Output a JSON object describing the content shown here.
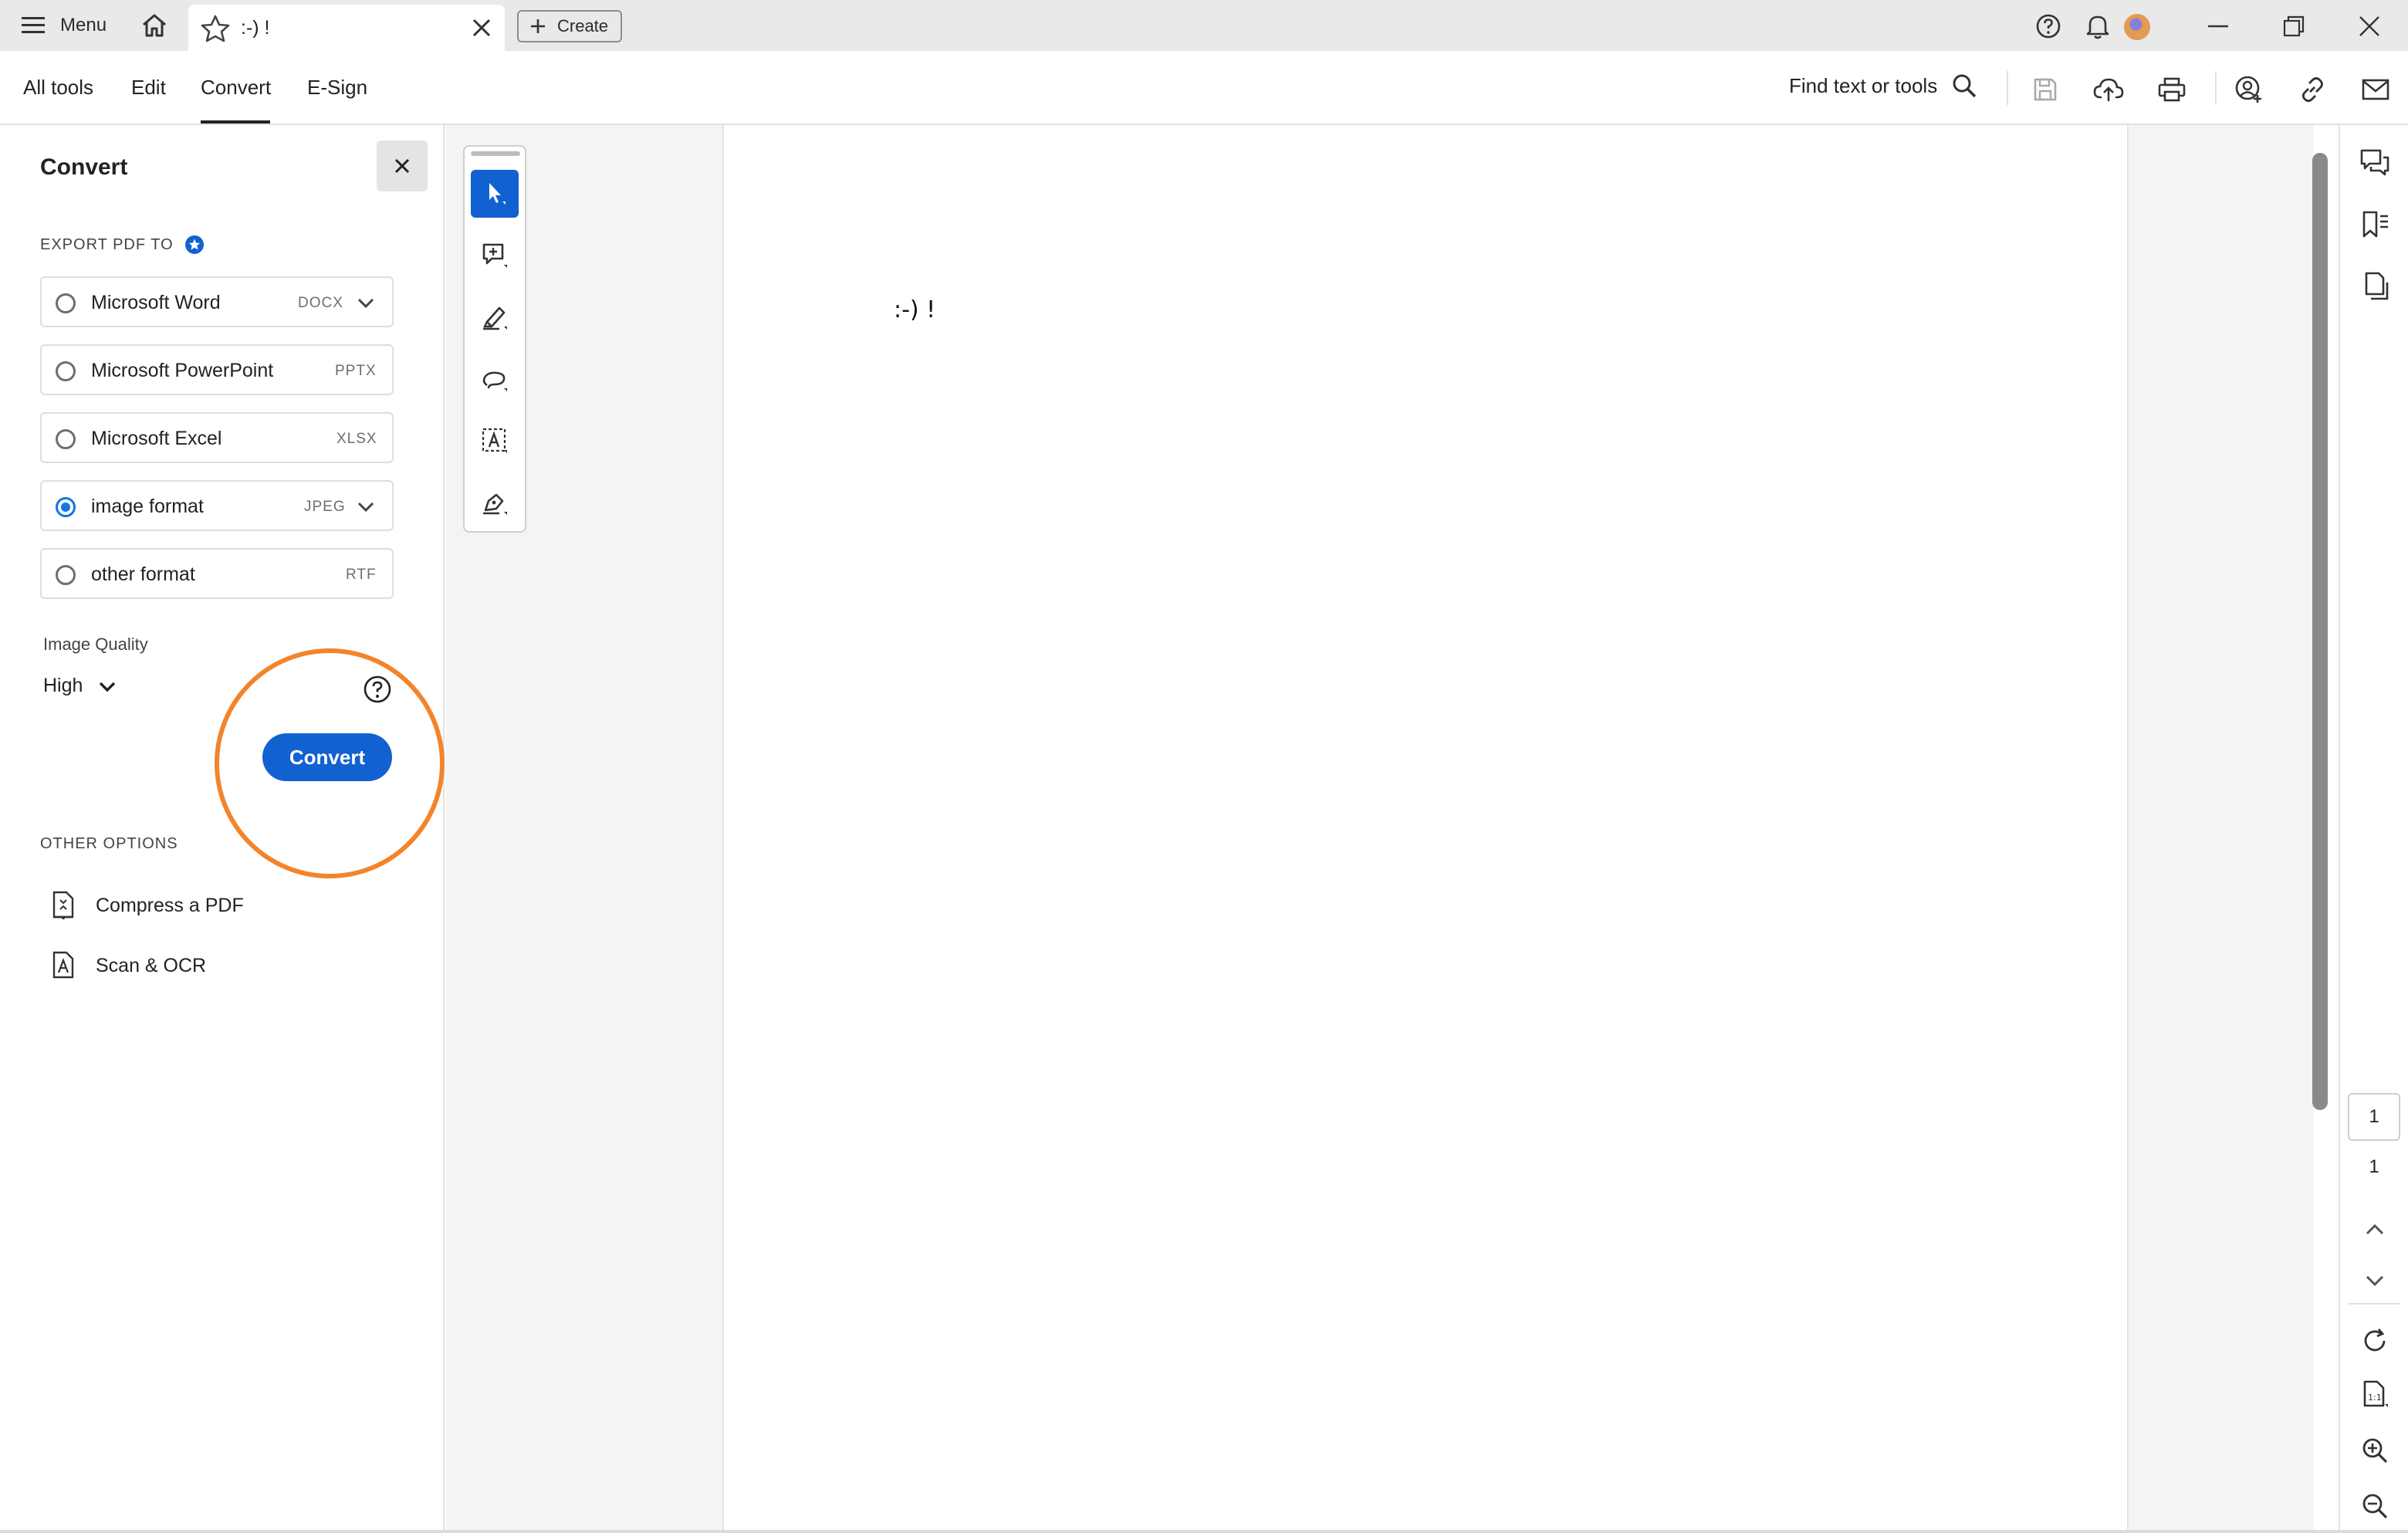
{
  "topbar": {
    "menu_label": "Menu",
    "tab_title": ":-) !",
    "create_label": "Create"
  },
  "toolbar": {
    "tabs": [
      {
        "label": "All tools"
      },
      {
        "label": "Edit"
      },
      {
        "label": "Convert"
      },
      {
        "label": "E-Sign"
      }
    ],
    "active_tab": "Convert",
    "find_label": "Find text or tools"
  },
  "convert_panel": {
    "title": "Convert",
    "export_heading": "EXPORT PDF TO",
    "options": [
      {
        "name": "Microsoft Word",
        "ext": "DOCX",
        "selected": false,
        "has_dropdown": true
      },
      {
        "name": "Microsoft PowerPoint",
        "ext": "PPTX",
        "selected": false,
        "has_dropdown": false
      },
      {
        "name": "Microsoft Excel",
        "ext": "XLSX",
        "selected": false,
        "has_dropdown": false
      },
      {
        "name": "image format",
        "ext": "JPEG",
        "selected": true,
        "has_dropdown": true
      },
      {
        "name": "other format",
        "ext": "RTF",
        "selected": false,
        "has_dropdown": false
      }
    ],
    "image_quality_label": "Image Quality",
    "image_quality_value": "High",
    "convert_button": "Convert",
    "other_heading": "OTHER OPTIONS",
    "other_options": [
      {
        "label": "Compress a PDF",
        "icon": "compress-pdf-icon"
      },
      {
        "label": "Scan & OCR",
        "icon": "scan-ocr-icon"
      }
    ]
  },
  "tools": [
    "select-tool-icon",
    "add-comment-icon",
    "highlight-pen-icon",
    "freehand-draw-icon",
    "text-select-icon",
    "sign-icon"
  ],
  "document": {
    "text": ":-) !"
  },
  "page_nav": {
    "current_page": "1",
    "total_pages": "1"
  },
  "colors": {
    "accent": "#1261d1",
    "highlight_ring": "#f3842a",
    "topbar_bg": "#e9e9e9"
  }
}
